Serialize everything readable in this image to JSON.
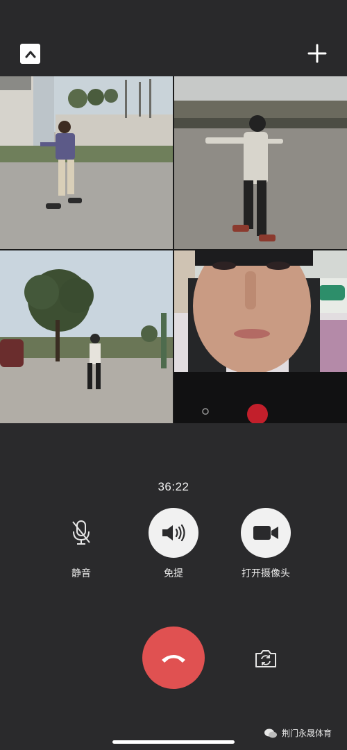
{
  "top_bar": {
    "collapse_icon": "chevron-up-icon",
    "add_icon": "plus-icon"
  },
  "participants": [
    {
      "id": "boy-plaid-sweater"
    },
    {
      "id": "girl-white-jacket"
    },
    {
      "id": "child-under-tree"
    },
    {
      "id": "self-view-woman"
    }
  ],
  "call": {
    "timer": "36:22",
    "mute_label": "静音",
    "speaker_label": "免提",
    "camera_label": "打开摄像头"
  },
  "icons": {
    "mute": "microphone-off-icon",
    "speaker": "speaker-icon",
    "camera": "video-camera-icon",
    "hangup": "hang-up-icon",
    "switch_camera": "switch-camera-icon"
  },
  "watermark": {
    "text": "荆门永晟体育"
  },
  "colors": {
    "background": "#2a2a2c",
    "hangup": "#e05151",
    "button": "#f1f1f1"
  }
}
